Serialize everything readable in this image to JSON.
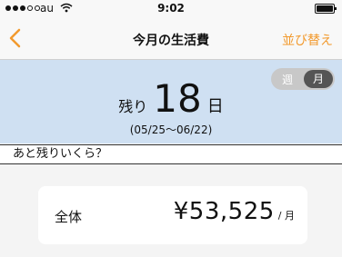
{
  "status_bar": {
    "carrier": "au",
    "time": "9:02"
  },
  "nav": {
    "back_icon": "chevron-left-icon",
    "title": "今月の生活費",
    "action_label": "並び替え",
    "accent_color": "#f29a2e"
  },
  "summary": {
    "toggle": {
      "week": "週",
      "month": "月",
      "selected": "月"
    },
    "remaining_prefix": "残り",
    "remaining_days": "18",
    "remaining_suffix": "日",
    "period": "(05/25〜06/22)",
    "background_color": "#cfe0f2"
  },
  "question": "あと残りいくら？",
  "total_card": {
    "label": "全体",
    "amount": "¥53,525",
    "unit": "/ 月"
  }
}
